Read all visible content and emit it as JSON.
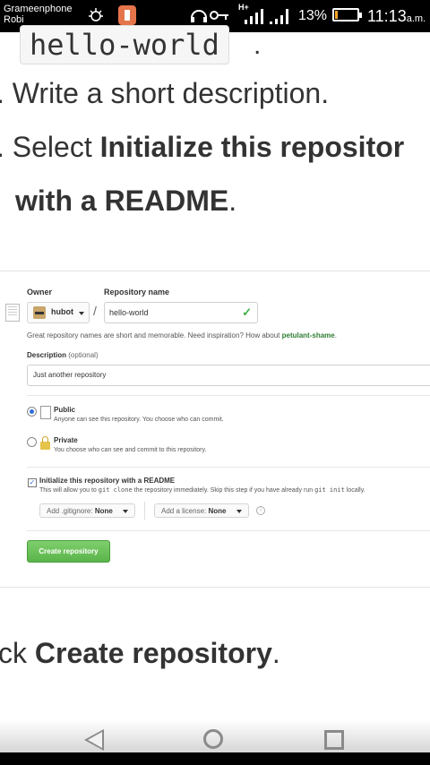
{
  "status_bar": {
    "carrier_line1": "Grameenphone",
    "carrier_line2": "Robi",
    "battery_percent": "13%",
    "battery_level": 0.13,
    "time": "11:13",
    "time_suffix": "a.m.",
    "network_label": "H+"
  },
  "doc": {
    "code_chip": "hello-world",
    "period": ".",
    "step_prefix": ".",
    "step_write": "Write a short description.",
    "step_select_text": "Select",
    "step_select_bold_1": "Initialize this repositor",
    "step_select_bold_2": "with a README",
    "step_click_partial": "ck",
    "step_click_bold": "Create repository"
  },
  "github_form": {
    "owner_label": "Owner",
    "repo_name_label": "Repository name",
    "owner_value": "hubot",
    "slash": "/",
    "repo_name_value": "hello-world",
    "name_hint": "Great repository names are short and memorable. Need inspiration? How about",
    "name_suggestion": "petulant-shame",
    "name_hint_end": ".",
    "description_label": "Description",
    "description_optional": "(optional)",
    "description_value": "Just another repository",
    "public_title": "Public",
    "public_desc": "Anyone can see this repository. You choose who can commit.",
    "private_title": "Private",
    "private_desc": "You choose who can see and commit to this repository.",
    "init_title": "Initialize this repository with a README",
    "init_desc_1": "This will allow you to",
    "init_code_1": "git clone",
    "init_desc_2": "the repository immediately. Skip this step if you have already run",
    "init_code_2": "git init",
    "init_desc_3": "locally.",
    "gitignore_label": "Add .gitignore:",
    "gitignore_value": "None",
    "license_label": "Add a license:",
    "license_value": "None",
    "info_glyph": "i",
    "create_button": "Create repository",
    "check_glyph": "✓",
    "checkbox_glyph": "✓"
  }
}
